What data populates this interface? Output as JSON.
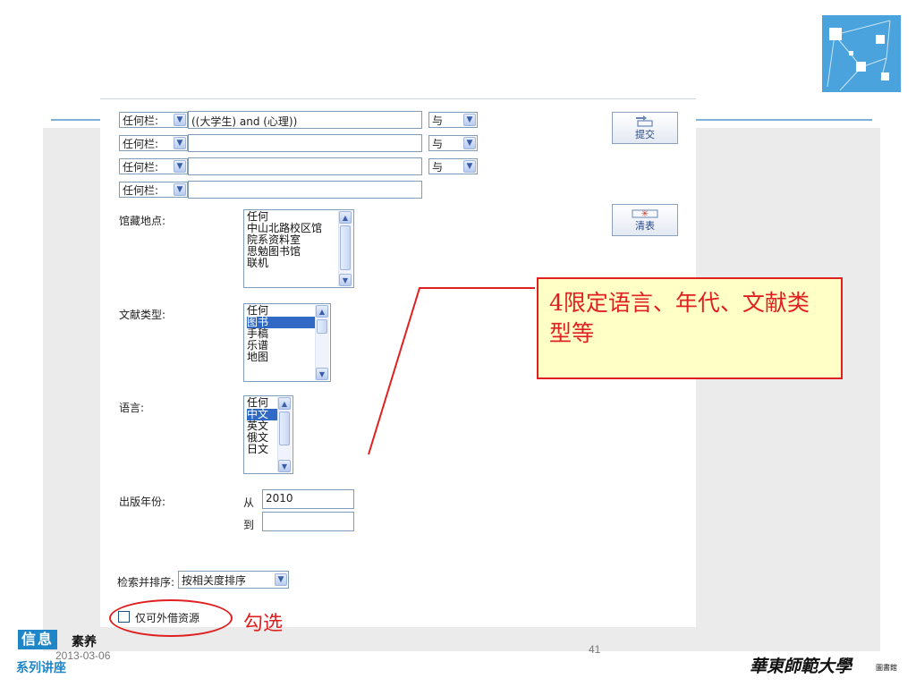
{
  "form": {
    "rows": [
      {
        "field": "任何栏:",
        "query": "((大学生) and (心理))",
        "op": "与"
      },
      {
        "field": "任何栏:",
        "query": "",
        "op": "与"
      },
      {
        "field": "任何栏:",
        "query": "",
        "op": "与"
      },
      {
        "field": "任何栏:",
        "query": ""
      }
    ],
    "submit_label": "提交",
    "clear_label": "清表",
    "location": {
      "label": "馆藏地点:",
      "options": [
        "任何",
        "中山北路校区馆",
        "院系资料室",
        "思勉图书馆",
        "联机"
      ]
    },
    "doctype": {
      "label": "文献类型:",
      "options": [
        "任何",
        "图书",
        "手稿",
        "乐谱",
        "地图"
      ],
      "selected": "图书"
    },
    "language": {
      "label": "语言:",
      "options": [
        "任何",
        "中文",
        "英文",
        "俄文",
        "日文"
      ],
      "selected": "中文"
    },
    "year": {
      "label": "出版年份:",
      "from_label": "从",
      "from_value": "2010",
      "to_label": "到",
      "to_value": ""
    },
    "sort": {
      "label": "检索并排序:",
      "value": "按相关度排序"
    },
    "borrowable": {
      "label": "仅可外借资源",
      "checked": false
    }
  },
  "annotations": {
    "callout_text": "4限定语言、年代、文献类型等",
    "tick_note": "勾选"
  },
  "slide": {
    "date": "2013-03-06",
    "page": "41",
    "series_logo": {
      "line1_boxed": "信息",
      "line1_rest": "素养",
      "line2": "系列讲座"
    },
    "university": "華東師範大學",
    "library": "圖書館"
  },
  "colors": {
    "accent_blue": "#2f8fce",
    "annotation_red": "#e02020",
    "callout_fill": "#ffffc6"
  }
}
